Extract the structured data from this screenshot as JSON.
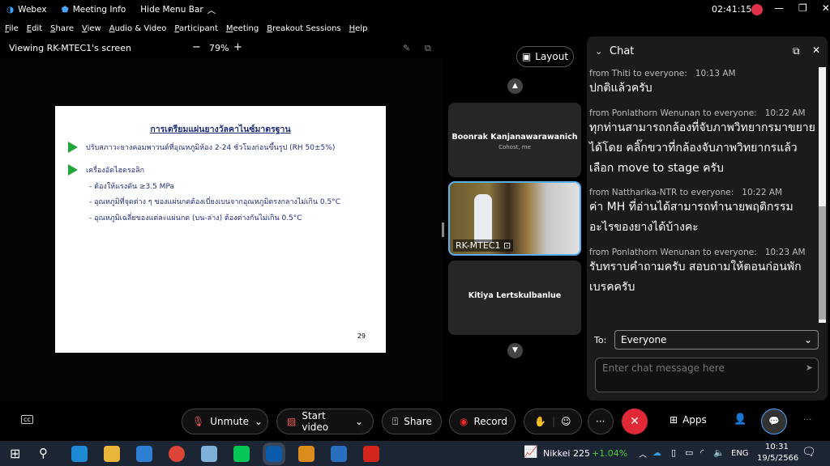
{
  "topbar": {
    "app": "Webex",
    "meeting_info": "Meeting Info",
    "hide_menu": "Hide Menu Bar",
    "clock": "02:41:15"
  },
  "menu": [
    "File",
    "Edit",
    "Share",
    "View",
    "Audio & Video",
    "Participant",
    "Meeting",
    "Breakout Sessions",
    "Help"
  ],
  "view": {
    "label": "Viewing RK-MTEC1's screen",
    "zoom": "79%",
    "layout": "Layout"
  },
  "slide": {
    "title": "การเตรียมแผ่นยางวัลคาไนซ์มาตรฐาน",
    "bullet1": "ปรับสภาวะยางคอมพาวนด์ที่อุณหภูมิห้อง 2-24 ชั่วโมงก่อนขึ้นรูป (RH 50±5%)",
    "bullet2": "เครื่องอัดไฮดรอลิก",
    "subs": [
      "-  ต้องให้แรงดัน ≥3.5 MPa",
      "-  อุณหภูมิที่จุดต่าง ๆ ของแผ่นกดต้องเบี่ยงเบนจากอุณหภูมิตรงกลางไม่เกิน 0.5°C",
      "-  อุณหภูมิเฉลี่ยของแต่ละแผ่นกด (บน-ล่าง) ต้องต่างกันไม่เกิน 0.5°C"
    ],
    "page": "29"
  },
  "tiles": [
    {
      "name": "Boonrak Kanjanawarawanich",
      "role": "Cohost, me"
    },
    {
      "name": "RK-MTEC1"
    },
    {
      "name": "Kitiya Lertskulbanlue"
    }
  ],
  "chat": {
    "title": "Chat",
    "messages": [
      {
        "from": "from Thiti to everyone:",
        "time": "10:13 AM",
        "text": "ปกติแล้วครับ"
      },
      {
        "from": "from Ponlathorn Wenunan to everyone:",
        "time": "10:22 AM",
        "text": "ทุกท่านสามารถกล้องที่จับภาพวิทยากรมาขยายได้โดย คลิ๊กขวาที่กล้องจับภาพวิทยากรแล้วเลือก move to stage ครับ"
      },
      {
        "from": "from Nattharika-NTR to everyone:",
        "time": "10:22 AM",
        "text": "ค่า MH ที่อ่านได้สามารถทำนายพฤติกรรมอะไรของยางได้บ้างคะ"
      },
      {
        "from": "from Ponlathorn Wenunan to everyone:",
        "time": "10:23 AM",
        "text": "รับทราบคำถามครับ สอบถามให้ตอนก่อนพักเบรคครับ"
      }
    ],
    "to_label": "To:",
    "to_value": "Everyone",
    "placeholder": "Enter chat message here"
  },
  "controls": {
    "unmute": "Unmute",
    "video": "Start video",
    "share": "Share",
    "record": "Record",
    "apps": "Apps",
    "end_color": "#e02836"
  },
  "taskbar": {
    "ticker": "Nikkei 225",
    "change": "+1.04%",
    "lang": "ENG",
    "time": "10:31",
    "date": "19/5/2566"
  }
}
